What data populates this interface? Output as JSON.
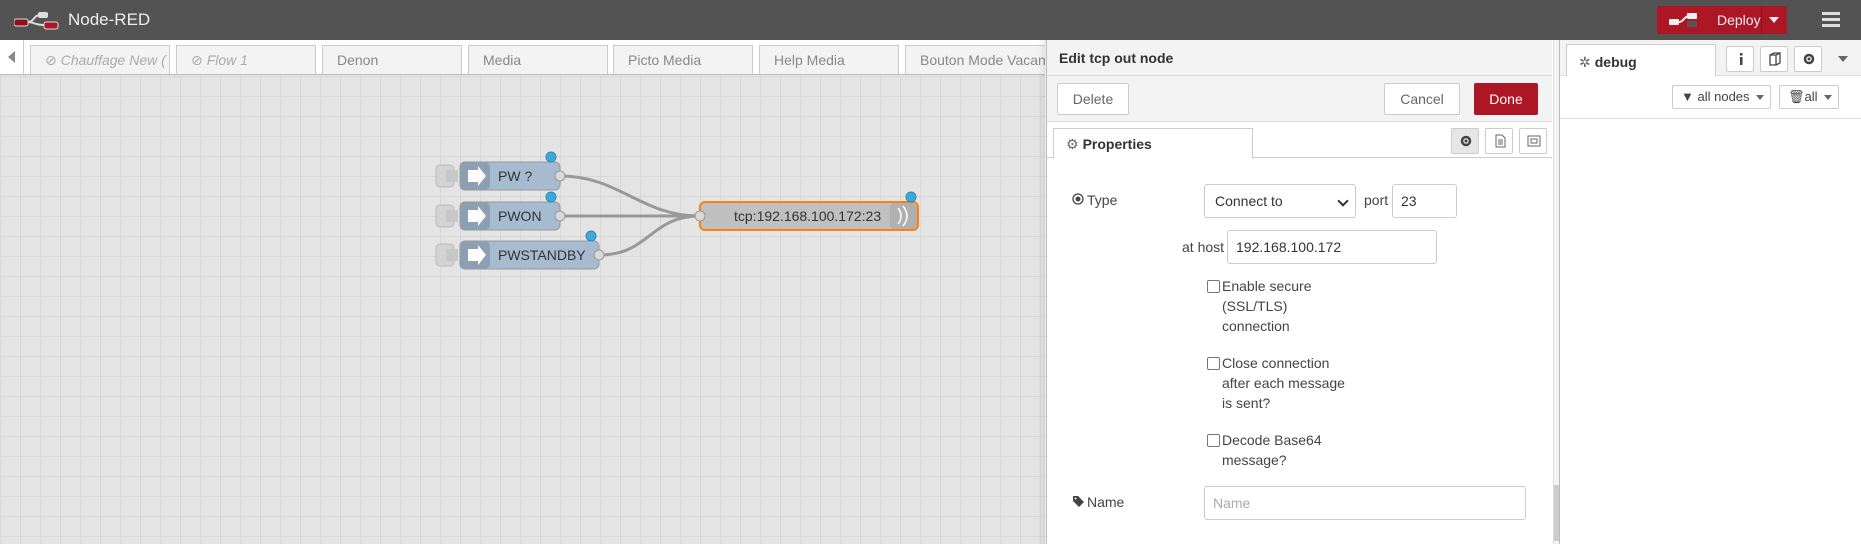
{
  "header": {
    "app_title": "Node-RED",
    "deploy_label": "Deploy",
    "logo_icon": "node-red-logo-icon",
    "menu_icon": "hamburger-menu-icon",
    "brand_color": "#ad1625"
  },
  "workspace": {
    "tabs": [
      {
        "label": "Chauffage New (",
        "disabled": true
      },
      {
        "label": "Flow 1",
        "disabled": true
      },
      {
        "label": "Denon",
        "disabled": false
      },
      {
        "label": "Media",
        "disabled": false
      },
      {
        "label": "Picto Media",
        "disabled": false
      },
      {
        "label": "Help Media",
        "disabled": false
      },
      {
        "label": "Bouton Mode Vacan",
        "disabled": false
      }
    ],
    "nodes": [
      {
        "label": "PW ?",
        "type": "inject"
      },
      {
        "label": "PWON",
        "type": "inject"
      },
      {
        "label": "PWSTANDBY",
        "type": "inject"
      },
      {
        "label": "tcp:192.168.100.172:23",
        "type": "tcp out",
        "selected": true
      }
    ]
  },
  "tray": {
    "title": "Edit tcp out node",
    "delete_label": "Delete",
    "cancel_label": "Cancel",
    "done_label": "Done",
    "tab_label": "Properties",
    "form": {
      "type_label": "Type",
      "type_value": "Connect to",
      "port_label": "port",
      "port_value": "23",
      "host_label": "at host",
      "host_value": "192.168.100.172",
      "ssl_label_1": "Enable secure",
      "ssl_label_2": "(SSL/TLS)",
      "ssl_label_3": "connection",
      "close_label_1": "Close connection",
      "close_label_2": "after each message",
      "close_label_3": "is sent?",
      "base64_label_1": "Decode Base64",
      "base64_label_2": "message?",
      "name_label": "Name",
      "name_placeholder": "Name",
      "ssl_checked": false,
      "close_checked": false,
      "base64_checked": false
    }
  },
  "sidebar": {
    "tab_label": "debug",
    "filter_nodes_label": "all nodes",
    "clear_label": "all"
  }
}
